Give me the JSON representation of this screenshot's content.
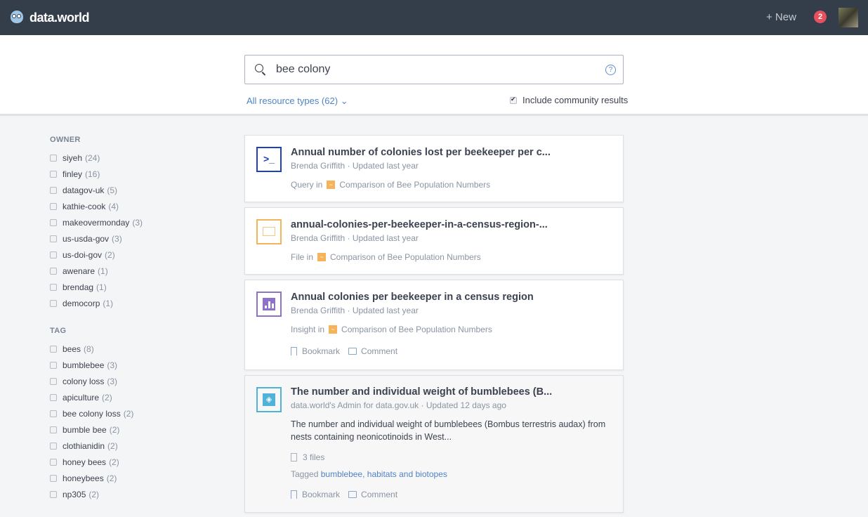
{
  "header": {
    "brand": "data.world",
    "new_label": "+ New",
    "notifications": "2"
  },
  "search": {
    "query": "bee colony",
    "help": "?",
    "resource_filter": "All resource types (62)",
    "community_label": "Include community results",
    "community_checked": true
  },
  "sidebar": {
    "owner_heading": "OWNER",
    "owners": [
      {
        "label": "siyeh",
        "count": "(24)"
      },
      {
        "label": "finley",
        "count": "(16)"
      },
      {
        "label": "datagov-uk",
        "count": "(5)"
      },
      {
        "label": "kathie-cook",
        "count": "(4)"
      },
      {
        "label": "makeovermonday",
        "count": "(3)"
      },
      {
        "label": "us-usda-gov",
        "count": "(3)"
      },
      {
        "label": "us-doi-gov",
        "count": "(2)"
      },
      {
        "label": "awenare",
        "count": "(1)"
      },
      {
        "label": "brendag",
        "count": "(1)"
      },
      {
        "label": "democorp",
        "count": "(1)"
      }
    ],
    "tag_heading": "TAG",
    "tags": [
      {
        "label": "bees",
        "count": "(8)"
      },
      {
        "label": "bumblebee",
        "count": "(3)"
      },
      {
        "label": "colony loss",
        "count": "(3)"
      },
      {
        "label": "apiculture",
        "count": "(2)"
      },
      {
        "label": "bee colony loss",
        "count": "(2)"
      },
      {
        "label": "bumble bee",
        "count": "(2)"
      },
      {
        "label": "clothianidin",
        "count": "(2)"
      },
      {
        "label": "honey bees",
        "count": "(2)"
      },
      {
        "label": "honeybees",
        "count": "(2)"
      },
      {
        "label": "np305",
        "count": "(2)"
      }
    ]
  },
  "results": [
    {
      "type": "query",
      "icon": "terminal-icon",
      "color": "#1f3fbf",
      "title": "Annual number of colonies lost per beekeeper per c...",
      "author": "Brenda Griffith",
      "updated": "Updated last year",
      "context_prefix": "Query in",
      "dataset": "Comparison of Bee Population Numbers"
    },
    {
      "type": "file",
      "icon": "image-icon",
      "color": "#f5b35a",
      "title": "annual-colonies-per-beekeeper-in-a-census-region-...",
      "author": "Brenda Griffith",
      "updated": "Updated last year",
      "context_prefix": "File in",
      "dataset": "Comparison of Bee Population Numbers"
    },
    {
      "type": "insight",
      "icon": "bar-chart-icon",
      "color": "#8e72c7",
      "title": "Annual colonies per beekeeper in a census region",
      "author": "Brenda Griffith",
      "updated": "Updated last year",
      "context_prefix": "Insight in",
      "dataset": "Comparison of Bee Population Numbers",
      "bookmark": "Bookmark",
      "comment": "Comment"
    },
    {
      "type": "dataset",
      "icon": "layers-icon",
      "color": "#4fb3d9",
      "title": "The number and individual weight of bumblebees (B...",
      "author": "data.world's Admin for data.gov.uk",
      "updated": "Updated 12 days ago",
      "description": "The number and individual weight of bumblebees (Bombus terrestris audax) from nests containing neonicotinoids in West...",
      "files": "3 files",
      "tagged_prefix": "Tagged",
      "tags": "bumblebee, habitats and biotopes",
      "bookmark": "Bookmark",
      "comment": "Comment"
    }
  ]
}
